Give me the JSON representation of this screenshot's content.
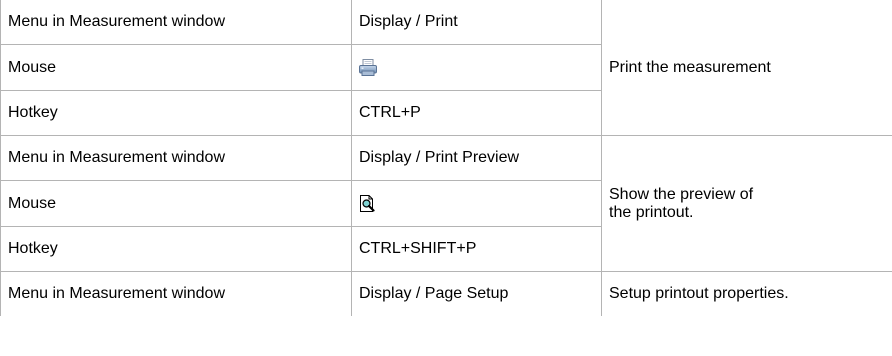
{
  "rows": [
    {
      "location": "Menu in Measurement window",
      "value": "Display / Print"
    },
    {
      "location": "Mouse",
      "icon": "printer-icon"
    },
    {
      "location": "Hotkey",
      "value": "CTRL+P"
    },
    {
      "location": "Menu in Measurement window",
      "value": "Display / Print Preview"
    },
    {
      "location": "Mouse",
      "icon": "print-preview-icon"
    },
    {
      "location": "Hotkey",
      "value": "CTRL+SHIFT+P"
    },
    {
      "location": "Menu in Measurement window",
      "value": "Display / Page Setup"
    }
  ],
  "descriptions": [
    "Print the measurement",
    "Show the preview of\nthe printout.",
    "Setup printout properties."
  ]
}
